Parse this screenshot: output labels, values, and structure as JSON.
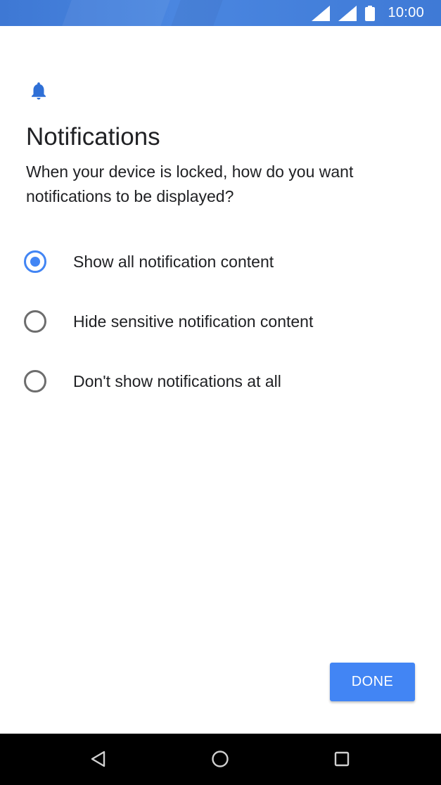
{
  "status_bar": {
    "time": "10:00",
    "icons": [
      "wifi-signal-icon",
      "cell-signal-icon",
      "battery-icon"
    ],
    "background": "#4a86e0"
  },
  "header": {
    "icon": "bell-icon",
    "title": "Notifications",
    "subtitle": "When your device is locked, how do you want notifications to be displayed?"
  },
  "options": [
    {
      "label": "Show all notification content",
      "selected": true
    },
    {
      "label": "Hide sensitive notification content",
      "selected": false
    },
    {
      "label": "Don't show notifications at all",
      "selected": false
    }
  ],
  "actions": {
    "done_label": "DONE"
  },
  "nav_bar": {
    "icons": [
      "back-icon",
      "home-icon",
      "recents-icon"
    ]
  },
  "colors": {
    "accent": "#4285f4",
    "text": "#202124",
    "radio_unselected": "#6d6d6d"
  }
}
